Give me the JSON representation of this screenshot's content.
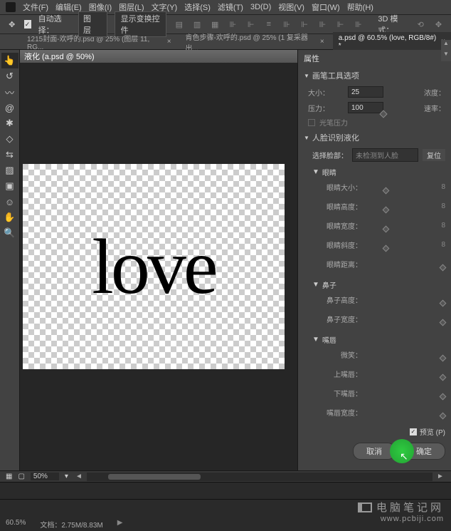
{
  "menu": {
    "items": [
      "文件(F)",
      "编辑(E)",
      "图像(I)",
      "图层(L)",
      "文字(Y)",
      "选择(S)",
      "滤镜(T)",
      "3D(D)",
      "视图(V)",
      "窗口(W)",
      "帮助(H)"
    ]
  },
  "optionbar": {
    "auto_select": "自动选择：",
    "layer_dd": "图层",
    "show_transform": "显示变换控件",
    "mode3d": "3D 模式："
  },
  "tabs": [
    {
      "label": "1215封面-欢呼的.psd @ 25% (图层 11, RG...",
      "active": false
    },
    {
      "label": "肯色步骤-欢呼的.psd @ 25% (1 复采器出...",
      "active": false
    },
    {
      "label": "a.psd @ 60.5% (love, RGB/8#) *",
      "active": true
    }
  ],
  "dialog_title": "液化 (a.psd @ 50%)",
  "canvas_text": "love",
  "panel": {
    "title": "属性",
    "brush_section": "画笔工具选项",
    "size_lbl": "大小：",
    "size_val": "25",
    "pressure_lbl": "压力：",
    "pressure_val": "100",
    "density_lbl": "浓度：",
    "rate_lbl": "速率：",
    "stylus": "光笔压力",
    "face_section": "人脸识别液化",
    "face_select_lbl": "选择脸部：",
    "face_select_val": "未检测到人脸",
    "face_reset": "复位",
    "eyes": "眼睛",
    "eye_size": "眼睛大小：",
    "eye_height": "眼睛高度：",
    "eye_width": "眼睛宽度：",
    "eye_tilt": "眼睛斜度：",
    "eye_dist": "眼睛距离：",
    "nose": "鼻子",
    "nose_height": "鼻子高度：",
    "nose_width": "鼻子宽度：",
    "mouth": "嘴唇",
    "smile": "微笑：",
    "upper_lip": "上嘴唇：",
    "lower_lip": "下嘴唇：",
    "mouth_width": "嘴唇宽度：",
    "link": "8",
    "preview": "预览 (P)",
    "cancel": "取消",
    "ok": "确定"
  },
  "docbar": {
    "zoom": "50%"
  },
  "footer": {
    "brand_cn": "电脑笔记网",
    "brand_url": "www.pcbiji.com",
    "zoom": "60.5%",
    "docinfo": "文档：2.75M/8.83M"
  }
}
